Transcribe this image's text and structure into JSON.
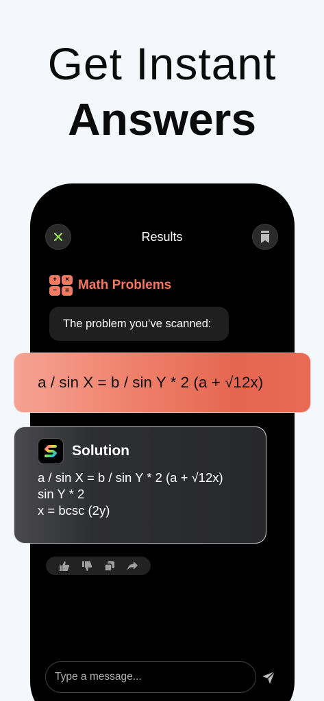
{
  "headline": {
    "line1": "Get Instant",
    "line2": "Answers"
  },
  "header": {
    "title": "Results"
  },
  "section": {
    "title": "Math Problems",
    "icon_symbols": [
      "+",
      "×",
      "−",
      "="
    ]
  },
  "scanned_bubble": {
    "text": "The problem you’ve scanned:"
  },
  "equation": {
    "text": "a / sin X = b / sin Y * 2 (a + √12x)"
  },
  "solution": {
    "title": "Solution",
    "lines": [
      "a / sin X = b / sin Y * 2 (a + √12x)",
      "sin Y * 2",
      "x = bcsc (2y)"
    ]
  },
  "input": {
    "placeholder": "Type a message..."
  },
  "colors": {
    "accent": "#f47960",
    "close_icon": "#9be15d",
    "phone_bg": "#000000",
    "page_bg": "#f4f7fb"
  },
  "icons": {
    "close": "close-icon",
    "bookmark": "bookmark-icon",
    "like": "thumbs-up-icon",
    "dislike": "thumbs-down-icon",
    "copy": "copy-icon",
    "share": "share-icon",
    "send": "send-icon"
  }
}
